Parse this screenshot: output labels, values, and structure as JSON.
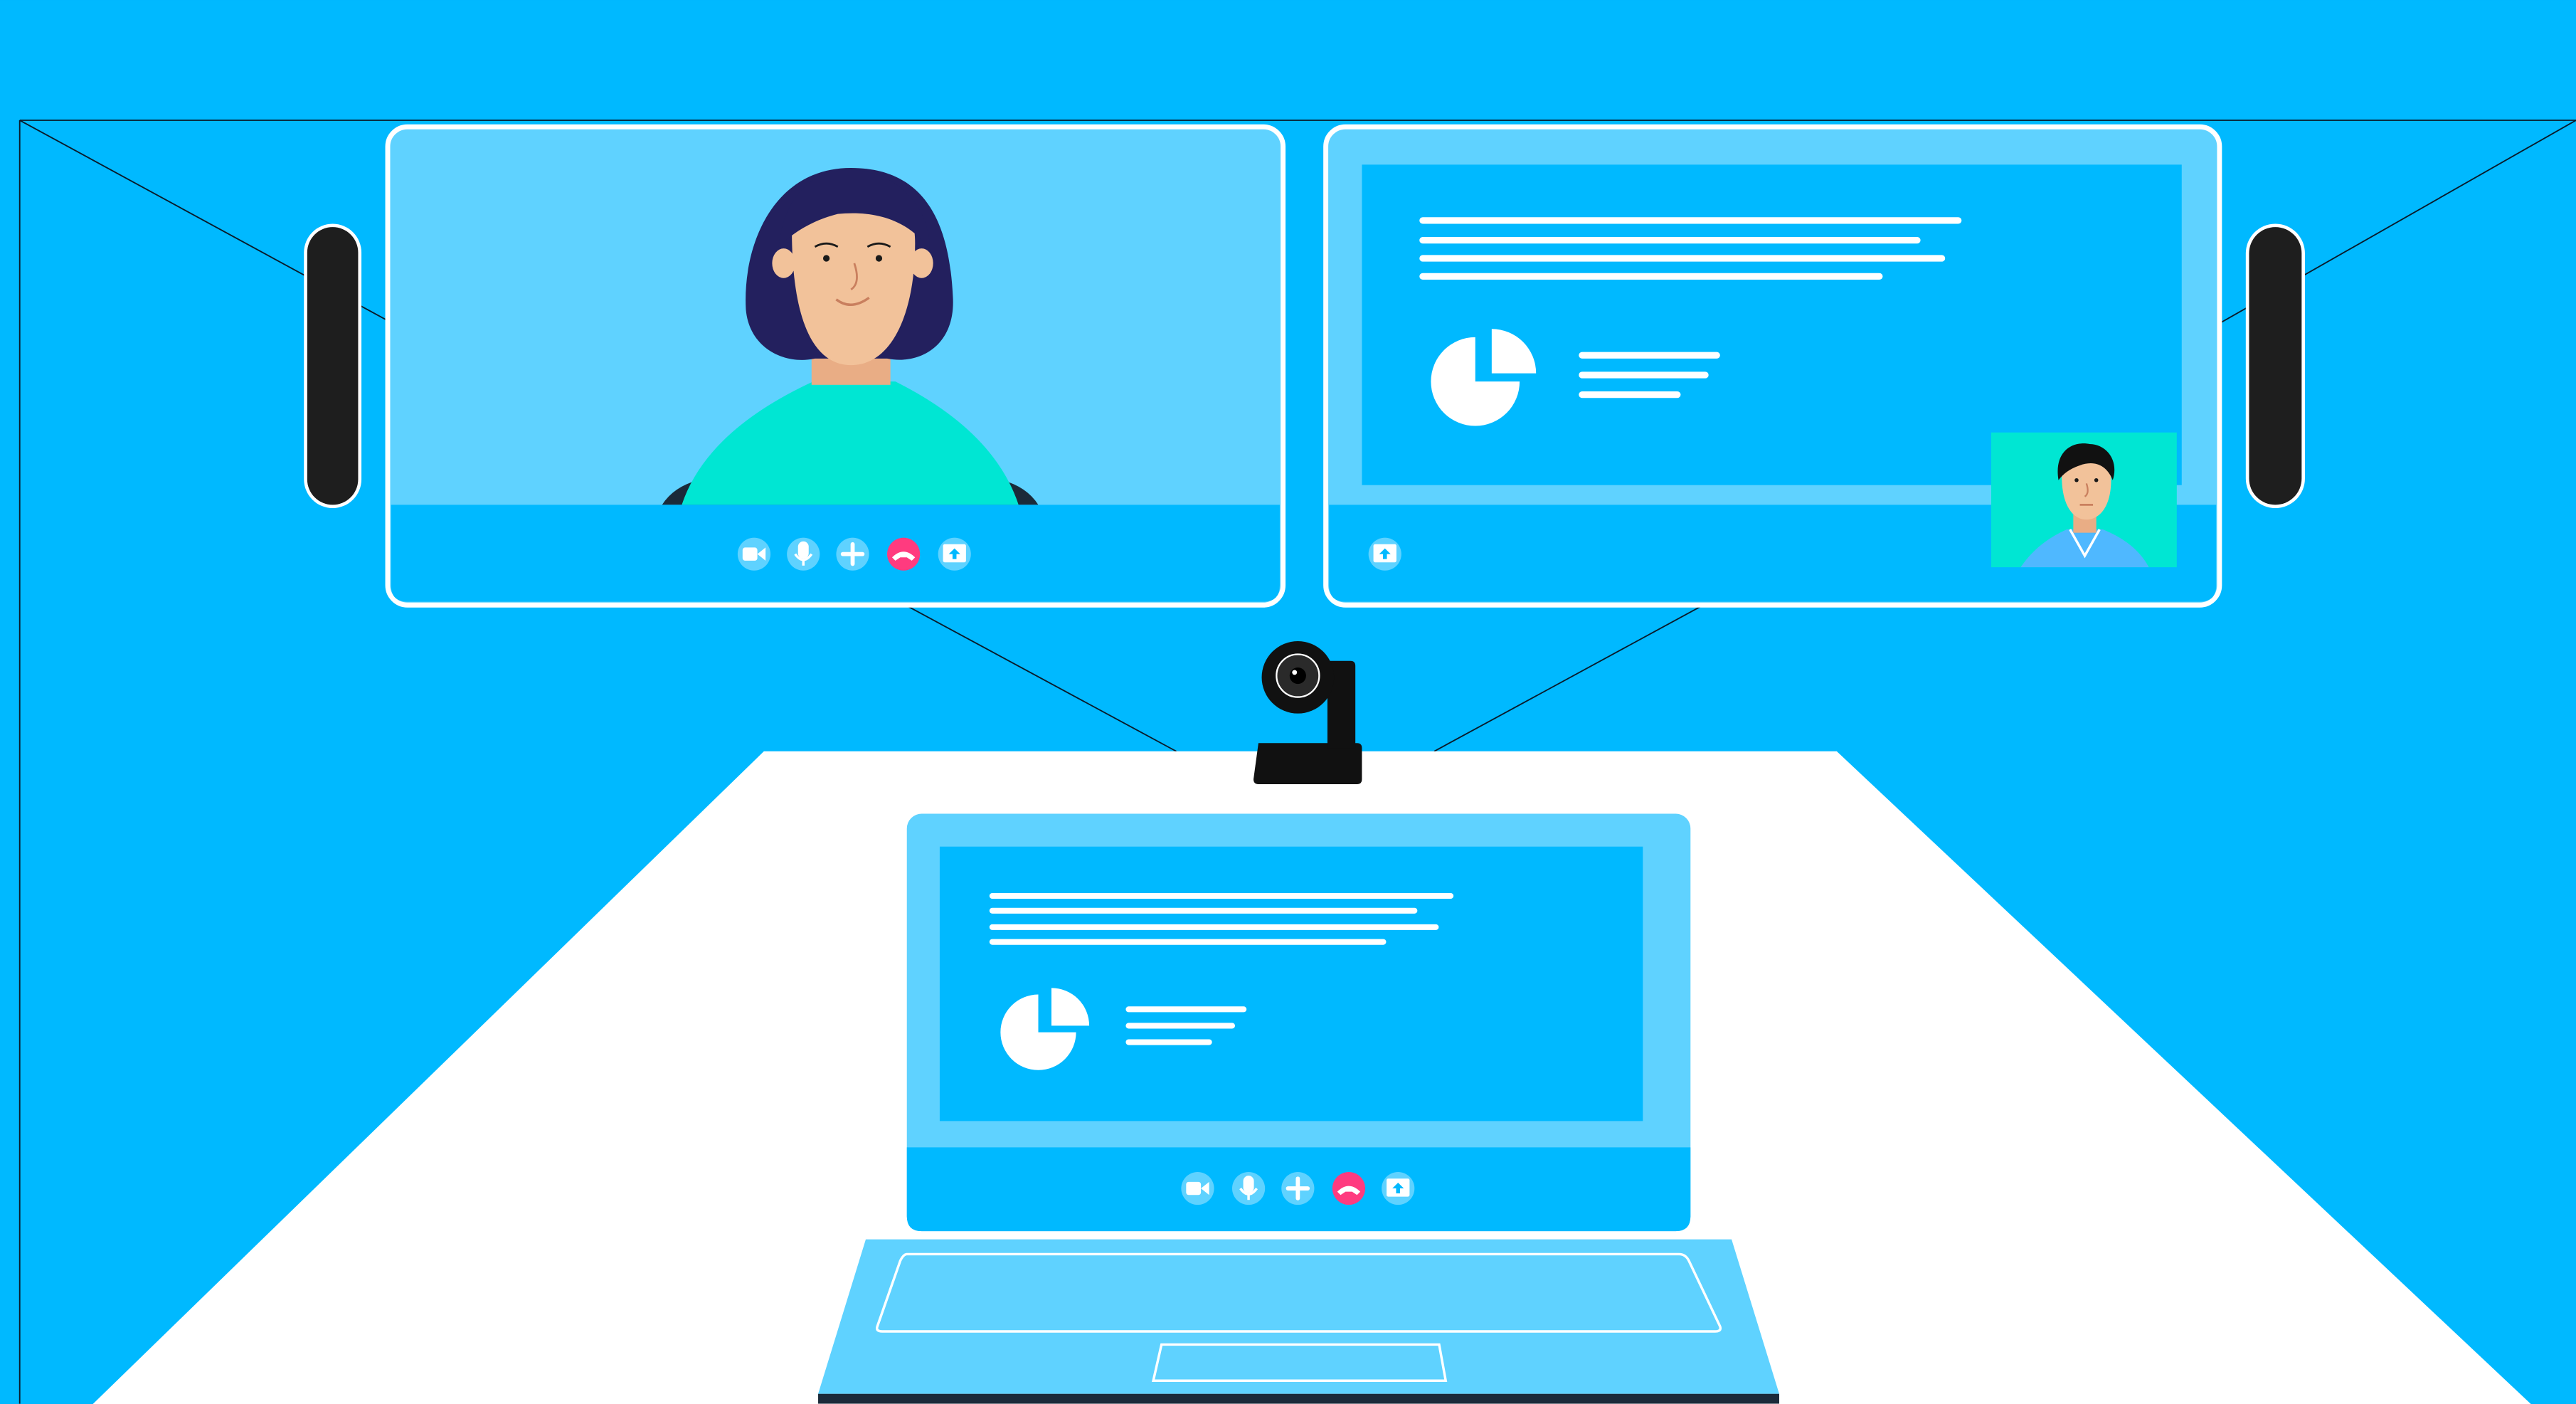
{
  "colors": {
    "wall": "#00b9ff",
    "table": "#ffffff",
    "screen_light": "#5fd2ff",
    "screen_frame": "#ffffff",
    "text_lines": "#ffffff",
    "end_call": "#ff3b7f",
    "speaker": "#1e1e1e",
    "camera": "#111111",
    "woman_hair": "#23205e",
    "skin": "#f2c29a",
    "shirt_teal": "#00e6d3",
    "man_shirt": "#4fb8ff",
    "pip_bg": "#00e6d3"
  },
  "left_display": {
    "participant": "woman",
    "controls": [
      "video-camera-icon",
      "microphone-icon",
      "plus-icon",
      "end-call-icon",
      "share-screen-icon"
    ]
  },
  "right_display": {
    "content": "presentation-slide",
    "pip_participant": "man",
    "controls": [
      "share-screen-icon"
    ]
  },
  "laptop": {
    "content": "presentation-slide",
    "controls": [
      "video-camera-icon",
      "microphone-icon",
      "plus-icon",
      "end-call-icon",
      "share-screen-icon"
    ]
  },
  "devices": [
    "left-speaker",
    "right-speaker",
    "webcam"
  ]
}
